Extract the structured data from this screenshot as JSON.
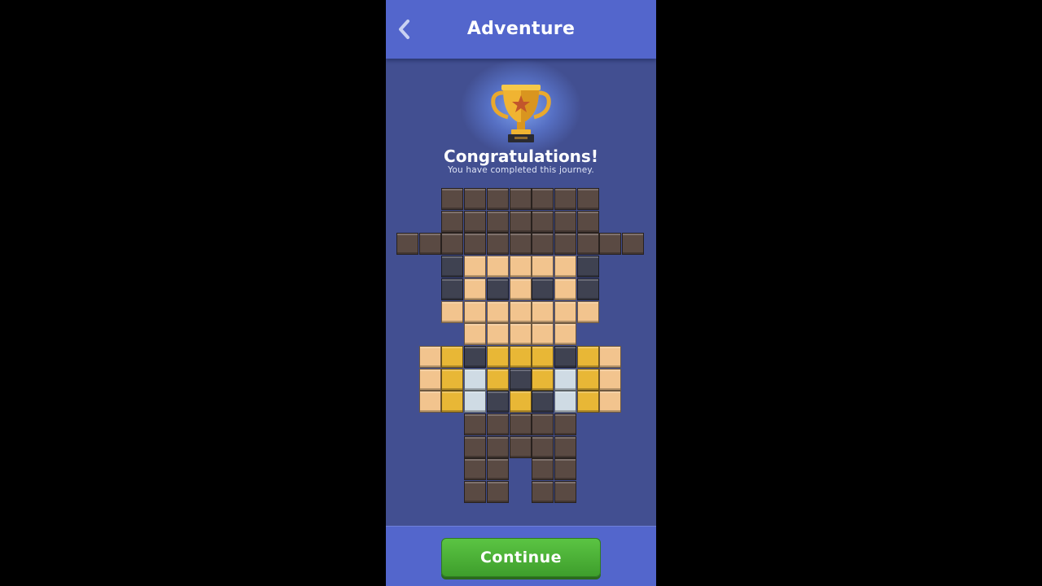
{
  "header": {
    "title": "Adventure",
    "back_icon": "chevron-left-icon"
  },
  "trophy": {
    "icon": "trophy-icon"
  },
  "message": {
    "title": "Congratulations!",
    "subtitle": "You have completed this journey."
  },
  "puzzle": {
    "palette": {
      "H": "#5a4a43",
      "S": "#f2c48e",
      "D": "#3f4251",
      "G": "#e8b736",
      "W": "#cfdbe4",
      ".": ""
    },
    "rows": [
      "..HHHHHHH..",
      "..HHHHHHH..",
      "HHHHHHHHHHH",
      "..DSSSSSD..",
      "..DSDSDSD..",
      "..SSSSSSS..",
      "...SSSSS...",
      ".SGDGGGDGS.",
      ".SGWGDGWGS.",
      ".SGWDGDWGS.",
      "...HHHHH...",
      "...HHHHH...",
      "...HH.HH...",
      "...HH.HH..."
    ]
  },
  "footer": {
    "continue_label": "Continue"
  },
  "colors": {
    "background": "#424f91",
    "header": "#5366cc",
    "button": "#4fb23a"
  }
}
